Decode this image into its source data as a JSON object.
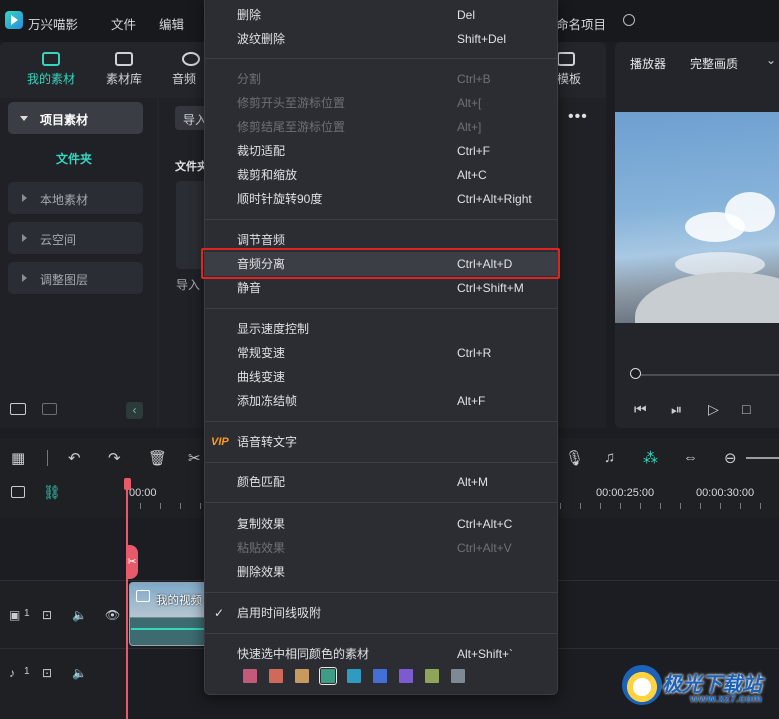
{
  "app": {
    "name": "万兴喵影",
    "menu": [
      "文件",
      "编辑"
    ],
    "project_title": "命名项目"
  },
  "media_tabs": [
    {
      "label": "我的素材",
      "active": true
    },
    {
      "label": "素材库"
    },
    {
      "label": "音频"
    },
    {
      "label": "模板"
    }
  ],
  "sidebar": {
    "project_media": "项目素材",
    "folder": "文件夹",
    "items": [
      "本地素材",
      "云空间",
      "调整图层"
    ]
  },
  "media_area": {
    "import_button": "导入",
    "folder_label": "文件夹",
    "import_caption": "导入"
  },
  "player": {
    "label": "播放器",
    "quality": "完整画质"
  },
  "timeline": {
    "timecodes": [
      "00:00",
      "00:00:25:00",
      "00:00:30:00"
    ],
    "clip_title": "我的视频",
    "track_video_num": "1",
    "track_audio_num": "1"
  },
  "context_menu": {
    "groups": [
      [
        {
          "label": "删除",
          "shortcut": "Del"
        },
        {
          "label": "波纹删除",
          "shortcut": "Shift+Del"
        }
      ],
      [
        {
          "label": "分割",
          "shortcut": "Ctrl+B",
          "disabled": true
        },
        {
          "label": "修剪开头至游标位置",
          "shortcut": "Alt+[",
          "disabled": true
        },
        {
          "label": "修剪结尾至游标位置",
          "shortcut": "Alt+]",
          "disabled": true
        },
        {
          "label": "裁切适配",
          "shortcut": "Ctrl+F"
        },
        {
          "label": "裁剪和缩放",
          "shortcut": "Alt+C"
        },
        {
          "label": "顺时针旋转90度",
          "shortcut": "Ctrl+Alt+Right"
        }
      ],
      [
        {
          "label": "调节音频",
          "shortcut": ""
        },
        {
          "label": "音频分离",
          "shortcut": "Ctrl+Alt+D",
          "highlighted": true
        },
        {
          "label": "静音",
          "shortcut": "Ctrl+Shift+M"
        }
      ],
      [
        {
          "label": "显示速度控制",
          "shortcut": ""
        },
        {
          "label": "常规变速",
          "shortcut": "Ctrl+R"
        },
        {
          "label": "曲线变速",
          "shortcut": ""
        },
        {
          "label": "添加冻结帧",
          "shortcut": "Alt+F"
        }
      ],
      [
        {
          "label": "语音转文字",
          "shortcut": "",
          "badge": "VIP"
        }
      ],
      [
        {
          "label": "颜色匹配",
          "shortcut": "Alt+M"
        }
      ],
      [
        {
          "label": "复制效果",
          "shortcut": "Ctrl+Alt+C"
        },
        {
          "label": "粘贴效果",
          "shortcut": "Ctrl+Alt+V",
          "disabled": true
        },
        {
          "label": "删除效果",
          "shortcut": ""
        }
      ],
      [
        {
          "label": "启用时间线吸附",
          "shortcut": "",
          "checked": true
        }
      ],
      [
        {
          "label": "快速选中相同颜色的素材",
          "shortcut": "Alt+Shift+`"
        }
      ]
    ],
    "color_swatches": [
      "#c45a79",
      "#cf6a5b",
      "#c79a5d",
      "#3d9b86",
      "#2f9bbf",
      "#4470d6",
      "#7b5bcf",
      "#8fa55a",
      "#7d8a94"
    ]
  },
  "watermark": {
    "text": "极光下载站",
    "url": "www.xz7.com"
  }
}
